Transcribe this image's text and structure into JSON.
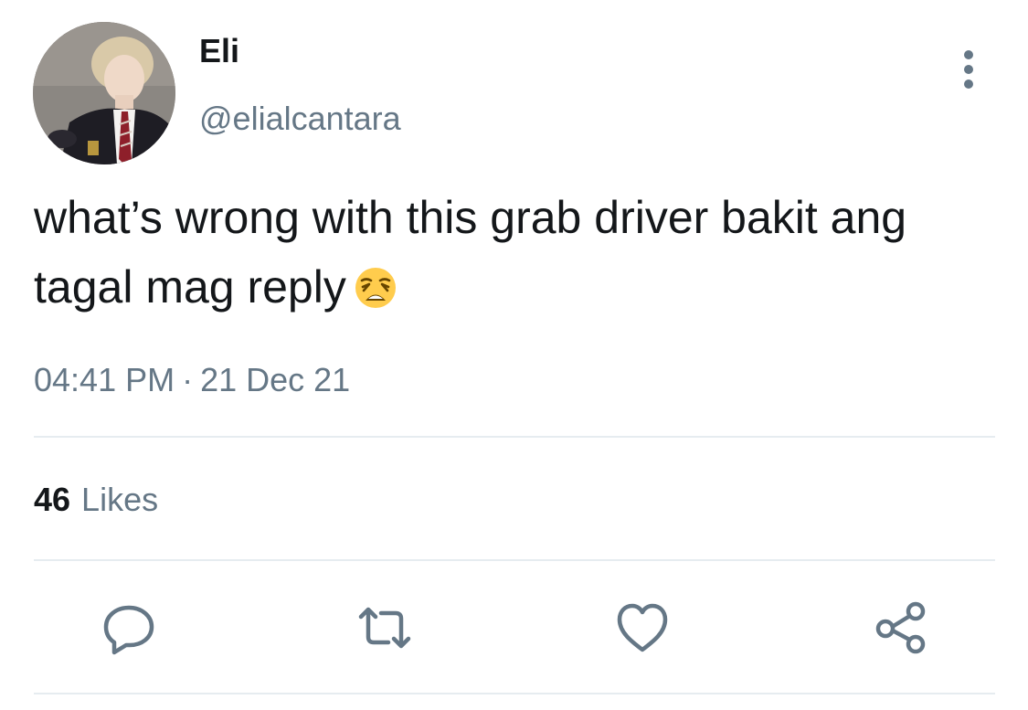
{
  "tweet": {
    "author": {
      "display_name": "Eli",
      "handle": "@elialcantara"
    },
    "text": "what’s wrong with this grab driver bakit ang tagal mag reply",
    "emoji": "weary-face-emoji",
    "time": "04:41 PM",
    "separator": "·",
    "date": "21 Dec 21",
    "likes": {
      "count": "46",
      "label": "Likes"
    }
  },
  "icons": {
    "more": "more-vertical-icon",
    "reply": "reply-icon",
    "retweet": "retweet-icon",
    "like": "heart-icon",
    "share": "share-icon"
  },
  "colors": {
    "primary_text": "#14171a",
    "secondary_text": "#657786",
    "divider": "#e6ecf0"
  }
}
